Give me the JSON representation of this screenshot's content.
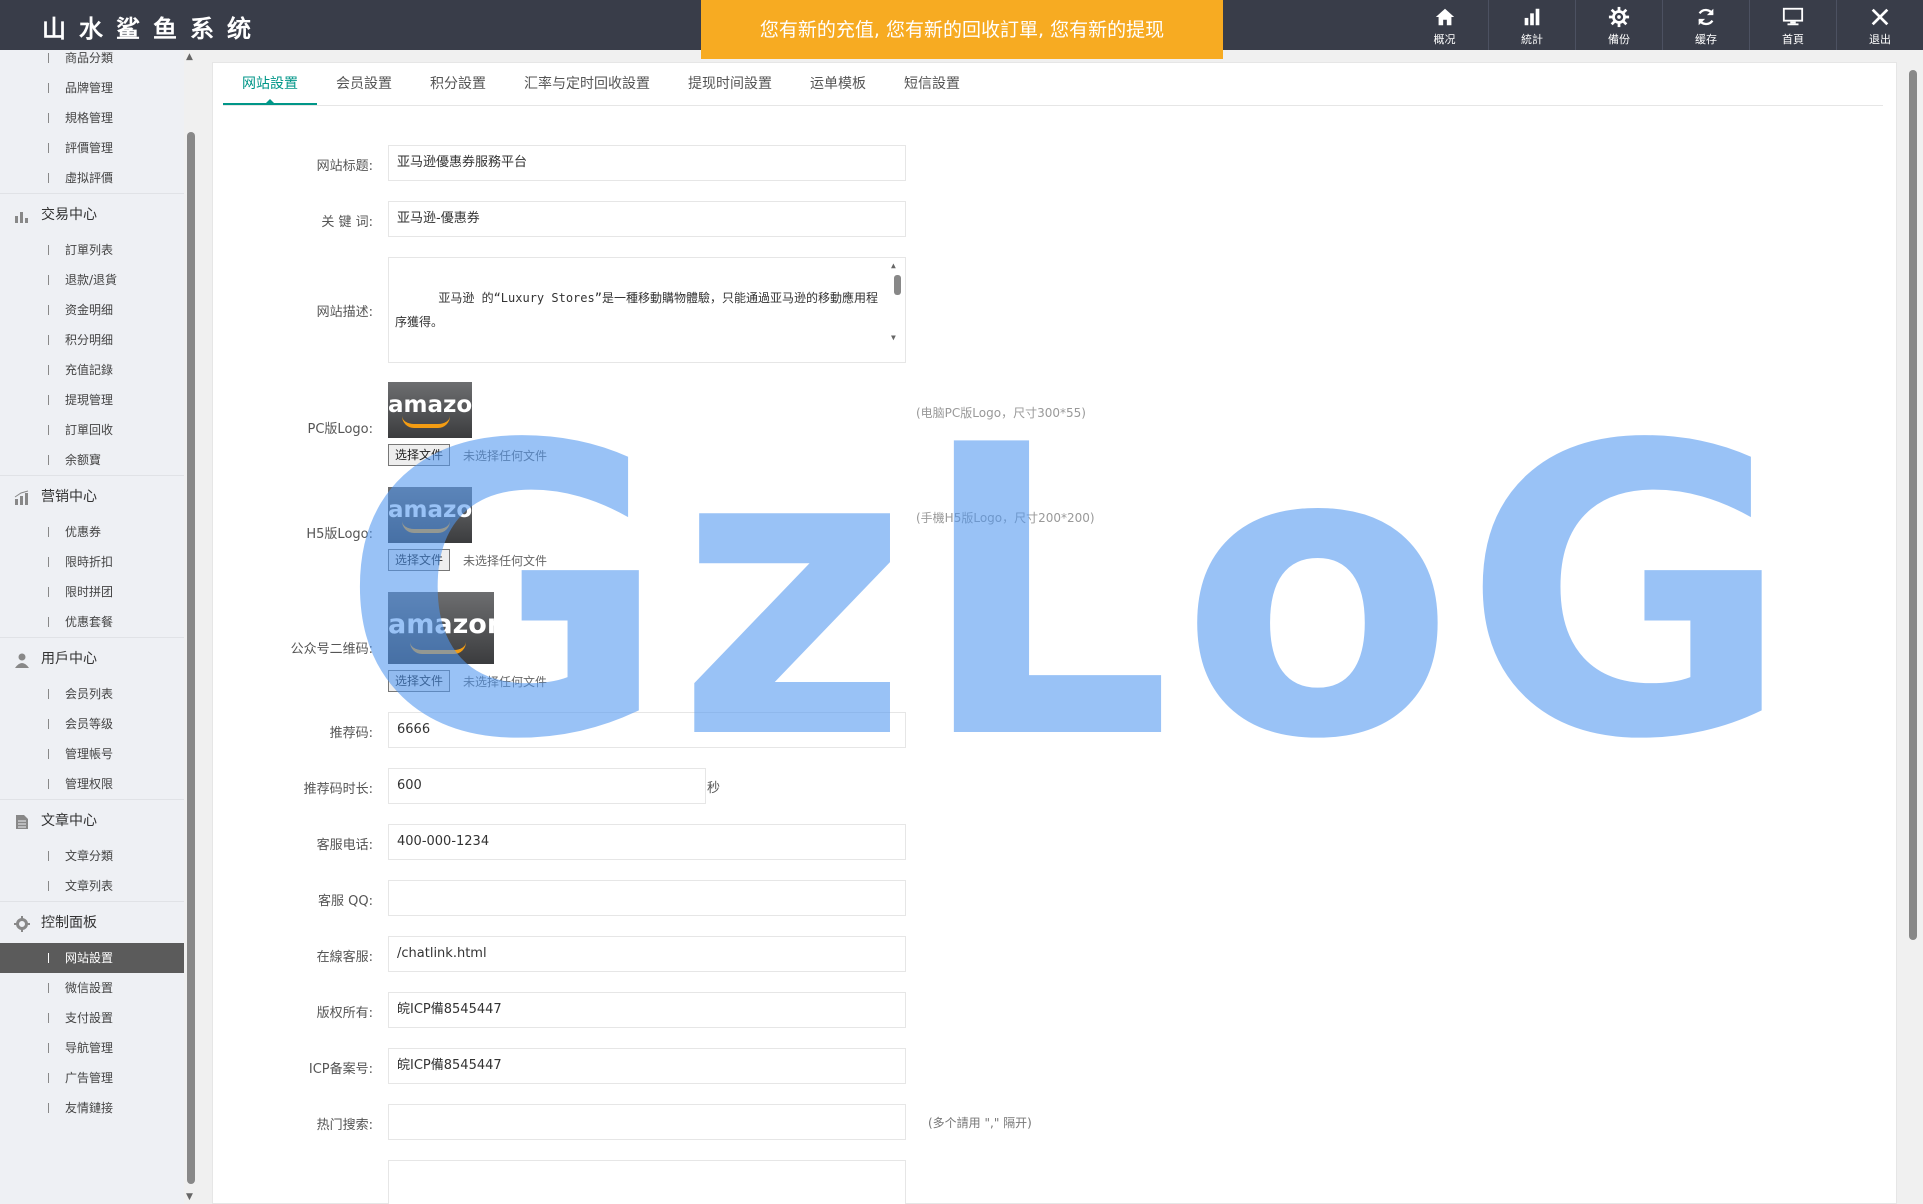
{
  "app": {
    "brand": "山水鲨鱼系统"
  },
  "notice": "您有新的充值, 您有新的回收訂單, 您有新的提现",
  "toolbar": [
    {
      "label": "概况",
      "icon": "home-icon"
    },
    {
      "label": "統計",
      "icon": "bar-chart-icon"
    },
    {
      "label": "備份",
      "icon": "gear-icon"
    },
    {
      "label": "缓存",
      "icon": "refresh-icon"
    },
    {
      "label": "首頁",
      "icon": "monitor-icon"
    },
    {
      "label": "退出",
      "icon": "close-icon"
    }
  ],
  "sidebar": {
    "top_items": [
      "商品分類",
      "品牌管理",
      "規格管理",
      "評價管理",
      "虛拟評價"
    ],
    "sections": [
      {
        "title": "交易中心",
        "icon": "chart-icon",
        "items": [
          "訂單列表",
          "退款/退貨",
          "资金明细",
          "积分明细",
          "充值記錄",
          "提現管理",
          "訂單回收",
          "余额寶"
        ]
      },
      {
        "title": "营销中心",
        "icon": "marketing-icon",
        "items": [
          "优惠券",
          "限時折扣",
          "限时拼团",
          "优惠套餐"
        ]
      },
      {
        "title": "用戶中心",
        "icon": "user-icon",
        "items": [
          "会员列表",
          "会员等级",
          "管理帳号",
          "管理权限"
        ]
      },
      {
        "title": "文章中心",
        "icon": "document-icon",
        "items": [
          "文章分類",
          "文章列表"
        ]
      },
      {
        "title": "控制面板",
        "icon": "gear-icon",
        "items": [
          "网站設置",
          "微信設置",
          "支付設置",
          "导航管理",
          "广告管理",
          "友情鏈接"
        ]
      }
    ],
    "active_item": "网站設置"
  },
  "tabs": [
    "网站設置",
    "会员設置",
    "积分設置",
    "汇率与定时回收設置",
    "提现时间設置",
    "运单模板",
    "短信設置"
  ],
  "form": {
    "site_title_label": "网站标题:",
    "site_title_value": "亚马逊優惠券服務平台",
    "keywords_label": "关 键 词:",
    "keywords_value": "亚马逊-優惠券",
    "description_label": "网站描述:",
    "description_value": "亚马逊 的“Luxury Stores”是一種移動購物體驗，只能通過亚马逊的移動應用程序獲得。\n\n阿里巴巴將Luxury Stores描述為“奢侈品的下一個目的地”和“世界上最受歡",
    "pc_logo_label": "PC版Logo:",
    "pc_logo_hint": "(电脑PC版Logo，尺寸300*55)",
    "h5_logo_label": "H5版Logo:",
    "h5_logo_hint": "(手機H5版Logo，尺寸200*200)",
    "qrcode_label": "公众号二维码:",
    "logo_text": "amazon",
    "file_button": "选择文件",
    "file_none": "未选择任何文件",
    "ref_code_label": "推荐码:",
    "ref_code_value": "6666",
    "ref_duration_label": "推荐码时长:",
    "ref_duration_value": "600",
    "ref_duration_unit": "秒",
    "phone_label": "客服电话:",
    "phone_value": "400-000-1234",
    "qq_label": "客服 QQ:",
    "qq_value": "",
    "online_label": "在線客服:",
    "online_value": "/chatlink.html",
    "copyright_label": "版权所有:",
    "copyright_value": "皖ICP備8545447",
    "icp_label": "ICP备案号:",
    "icp_value": "皖ICP備8545447",
    "hot_search_label": "热门搜索:",
    "hot_search_value": "",
    "hot_search_hint": "(多个請用 \",\" 隔开)"
  },
  "watermark": "GzLoG",
  "colors": {
    "topbar": "#393d49",
    "notice": "#f7ab22",
    "accent": "#009688",
    "sidebar": "#eef0f4",
    "active_item": "#5b5b5b"
  }
}
